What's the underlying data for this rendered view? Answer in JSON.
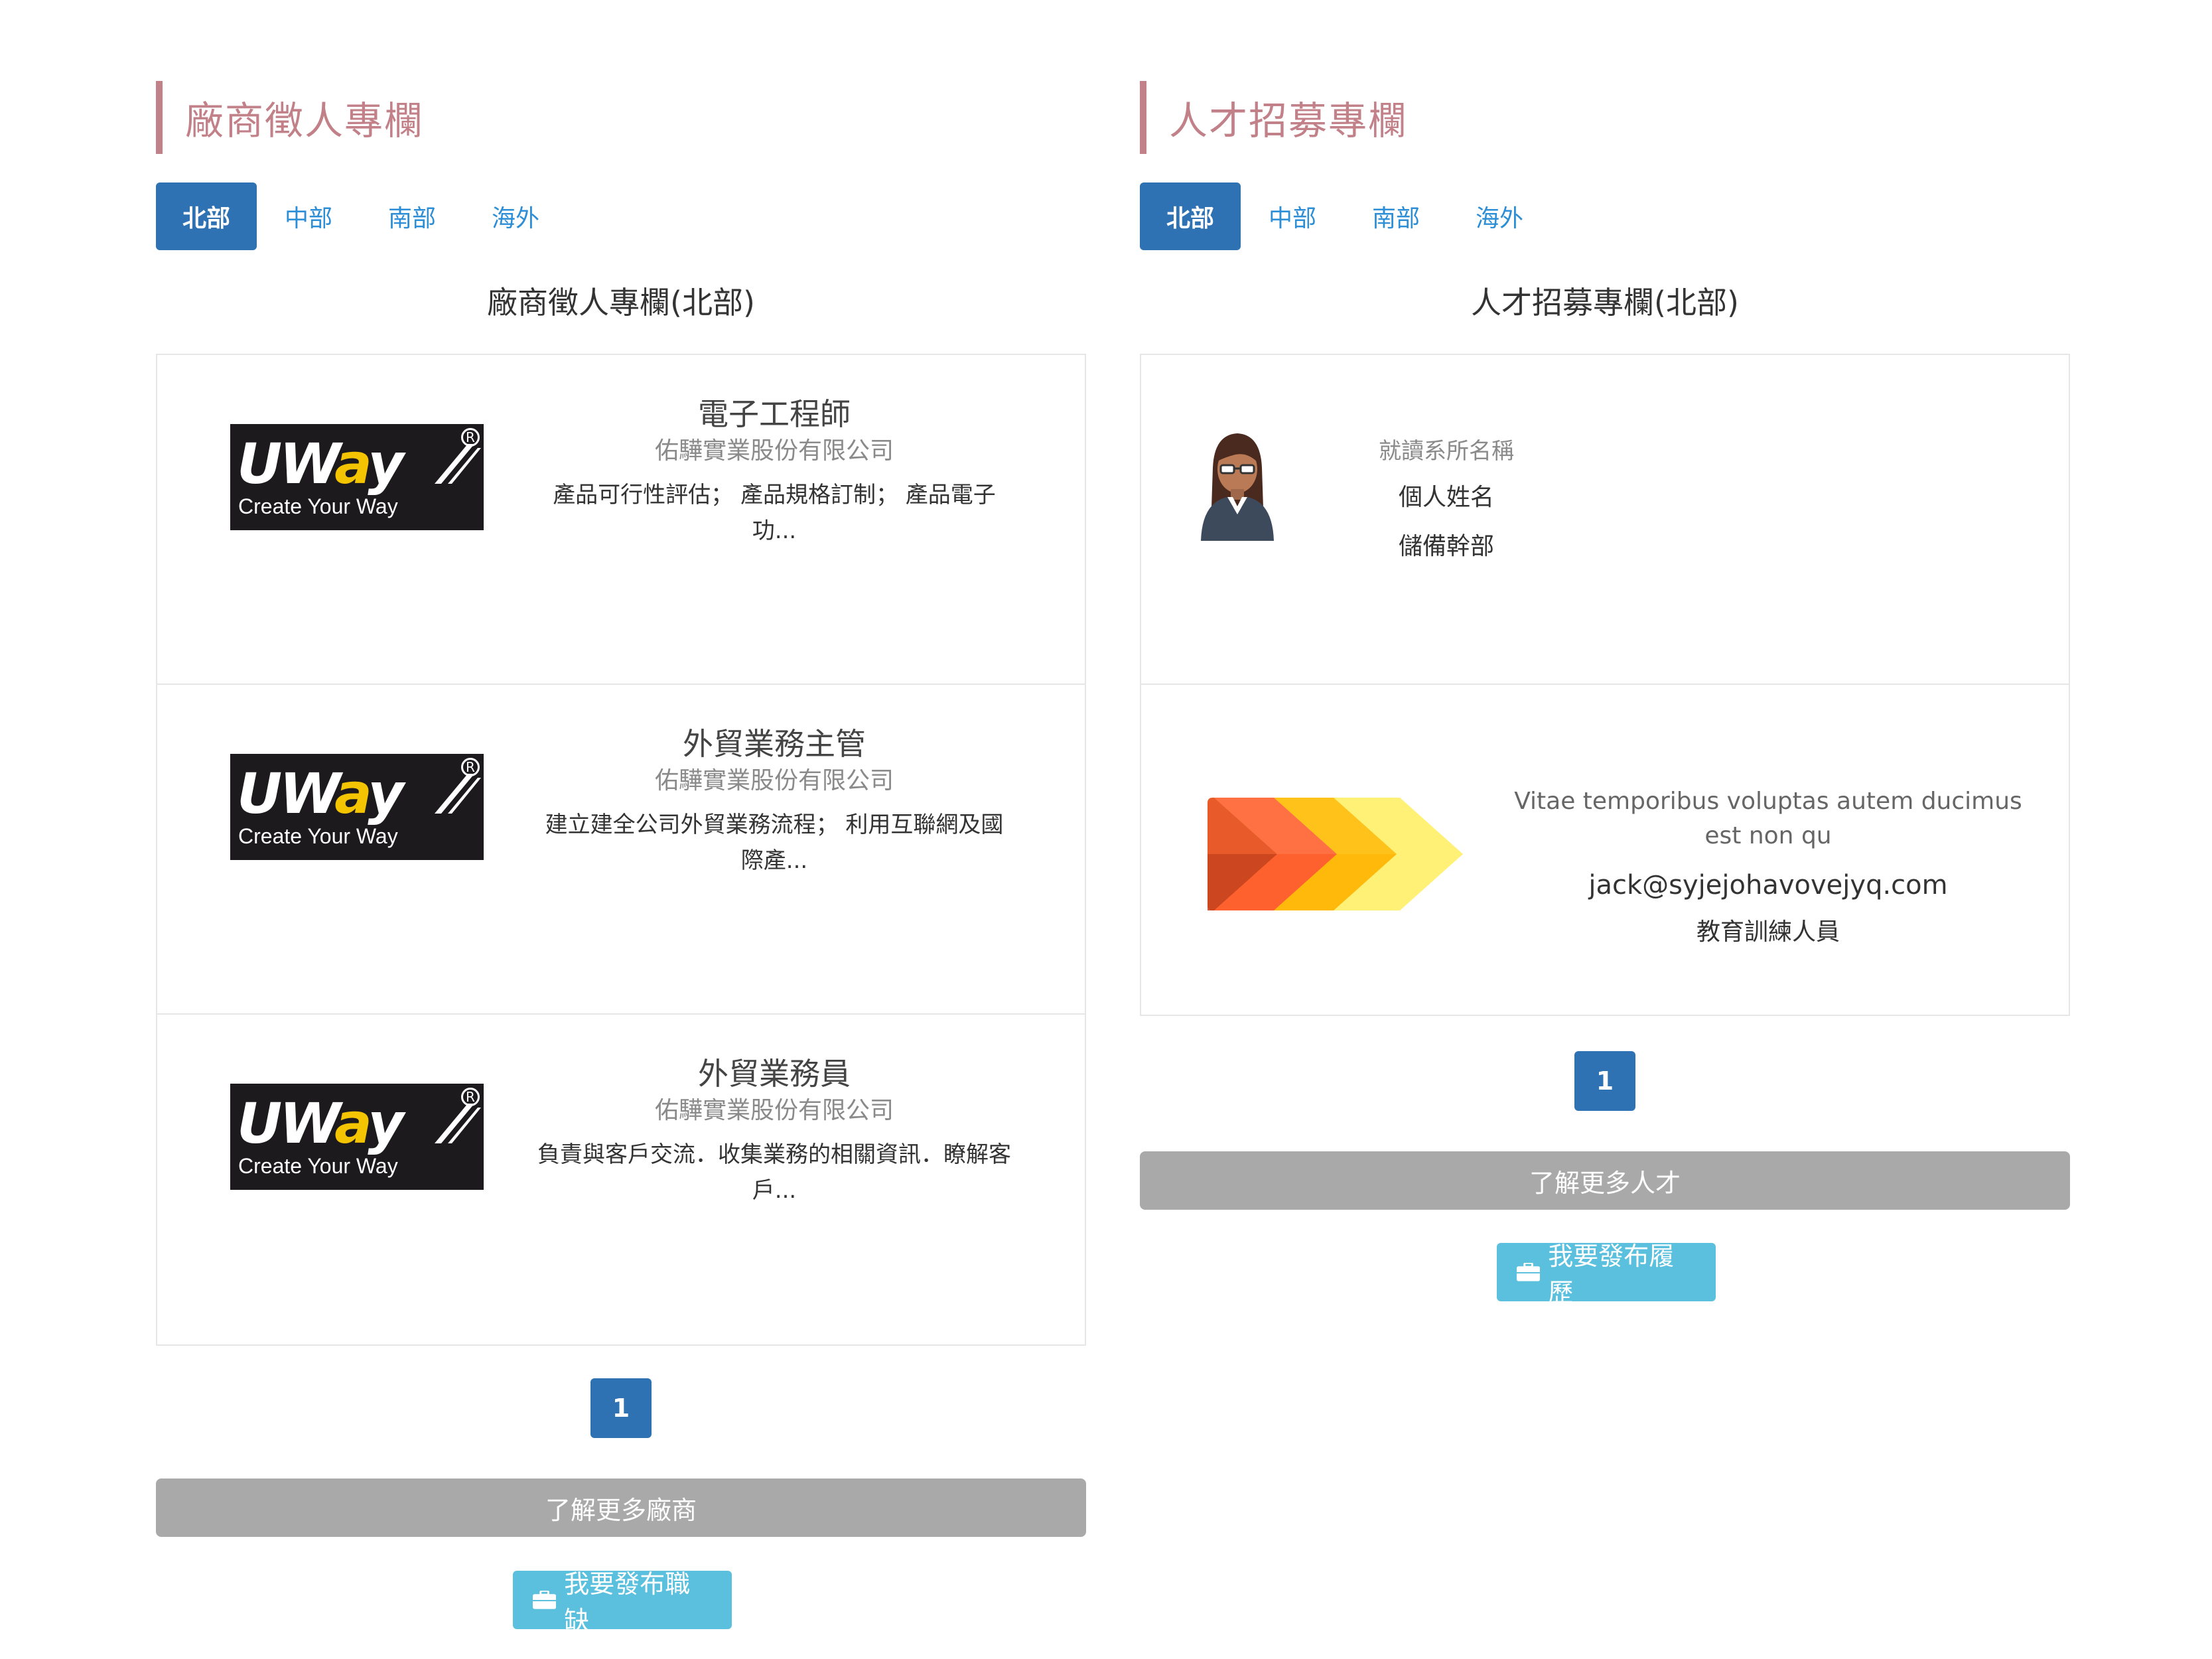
{
  "employers": {
    "heading": "廠商徵人專欄",
    "tabs": [
      "北部",
      "中部",
      "南部",
      "海外"
    ],
    "subtitle": "廠商徵人專欄(北部)",
    "logo": {
      "brand_text": "UWay",
      "brand_u": "U",
      "brand_w": "W",
      "brand_a": "a",
      "brand_y": "y",
      "tagline": "Create Your Way",
      "registered": "R"
    },
    "jobs": [
      {
        "title": "電子工程師",
        "company": "佑驊實業股份有限公司",
        "description": "產品可行性評估； 產品規格訂制； 產品電子功..."
      },
      {
        "title": "外貿業務主管",
        "company": "佑驊實業股份有限公司",
        "description": "建立建全公司外貿業務流程； 利用互聯網及國際產..."
      },
      {
        "title": "外貿業務員",
        "company": "佑驊實業股份有限公司",
        "description": "負責與客戶交流．收集業務的相關資訊．瞭解客戶..."
      }
    ],
    "page": "1",
    "more_label": "了解更多廠商",
    "post_label": "我要發布職缺"
  },
  "talents": {
    "heading": "人才招募專欄",
    "tabs": [
      "北部",
      "中部",
      "南部",
      "海外"
    ],
    "subtitle": "人才招募專欄(北部)",
    "people": [
      {
        "department": "就讀系所名稱",
        "name": "個人姓名",
        "role": "儲備幹部"
      },
      {
        "text": "Vitae temporibus voluptas autem ducimus est non qu",
        "email": "jack@syjejohavovejyq.com",
        "role": "教育訓練人員"
      }
    ],
    "page": "1",
    "more_label": "了解更多人才",
    "post_label": "我要發布履歷"
  },
  "colors": {
    "accent_heading": "#c28088",
    "tab_active": "#2f72b4",
    "tab_link": "#2b8ed6",
    "more_button": "#a9a9a9",
    "post_button": "#5bc0de"
  },
  "icons": {
    "post_button_icon": "briefcase-icon",
    "talent_avatar": "woman-avatar-icon",
    "talent_logo": "chevron-arrows-icon"
  }
}
